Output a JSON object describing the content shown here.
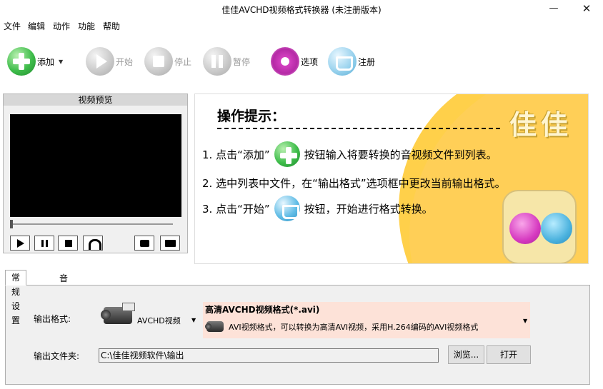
{
  "window": {
    "title": "佳佳AVCHD视频格式转换器 (未注册版本)",
    "minimize_glyph": "—",
    "close_glyph": "✕"
  },
  "menu": {
    "items": [
      "文件",
      "编辑",
      "动作",
      "功能",
      "帮助"
    ]
  },
  "toolbar": {
    "add_label": "添加",
    "add_dropdown_glyph": "▼",
    "start_label": "开始",
    "stop_label": "停止",
    "pause_label": "暂停",
    "options_label": "选项",
    "register_label": "注册"
  },
  "preview": {
    "title": "视频预览"
  },
  "tips": {
    "brand": "佳佳",
    "heading": "操作提示：",
    "step1_pre": "1. 点击“添加”",
    "step1_post": "按钮输入将要转换的音视频文件到列表。",
    "step2": "2. 选中列表中文件，在“输出格式”选项框中更改当前输出格式。",
    "step3_pre": "3. 点击“开始”",
    "step3_post": "按钮，开始进行格式转换。"
  },
  "tabs": {
    "general": "常规设置",
    "advanced": "音视频高级设置"
  },
  "settings": {
    "output_format_label": "输出格式:",
    "category_value": "AVCHD视频",
    "format_title": "高清AVCHD视频格式(*.avi)",
    "format_desc": "AVI视频格式，可以转换为高清AVI视频，采用H.264编码的AVI视频格式",
    "dropdown_glyph": "▼",
    "output_folder_label": "输出文件夹:",
    "output_folder_value": "C:\\佳佳视频软件\\输出",
    "browse_button": "浏览...",
    "open_button": "打开"
  },
  "colors": {
    "accent_yellow": "#ffcf57",
    "format_box_bg": "#fde2d8",
    "add_green": "#3fbd4b",
    "options_magenta": "#b52aa6",
    "register_blue": "#5aaed6"
  }
}
